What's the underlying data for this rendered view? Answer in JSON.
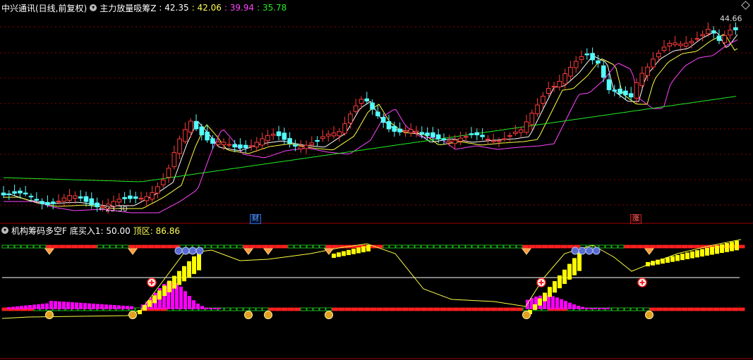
{
  "header": {
    "title": "中兴通讯(日线,前复权)",
    "indicator_name": "主力放量吸筹Z",
    "values": [
      {
        "text": ": 42.35",
        "color": "#ffffff"
      },
      {
        "text": ": 42.06",
        "color": "#ffff55"
      },
      {
        "text": ": 39.94",
        "color": "#ff44ff"
      },
      {
        "text": ": 35.78",
        "color": "#22ee22"
      }
    ]
  },
  "sub_header": {
    "indicator_name": "机构筹码多空F",
    "label_bottom": "底买入1: 50.00",
    "label_top": "顶区: 86.86"
  },
  "annotations": {
    "high_label": "44.66",
    "low_label": "23.30",
    "badge_finance": "财",
    "badge_up": "涨"
  },
  "colors": {
    "up": "#ff3c3c",
    "down": "#54ffff",
    "ma_white": "#ffffff",
    "ma_yellow": "#ffff44",
    "ma_magenta": "#ff44ff",
    "ma_green": "#22ee22",
    "grid": "#8b0000",
    "hist": "#ff00ff",
    "yellow_bar": "#ffff00",
    "bg": "#000000"
  }
}
